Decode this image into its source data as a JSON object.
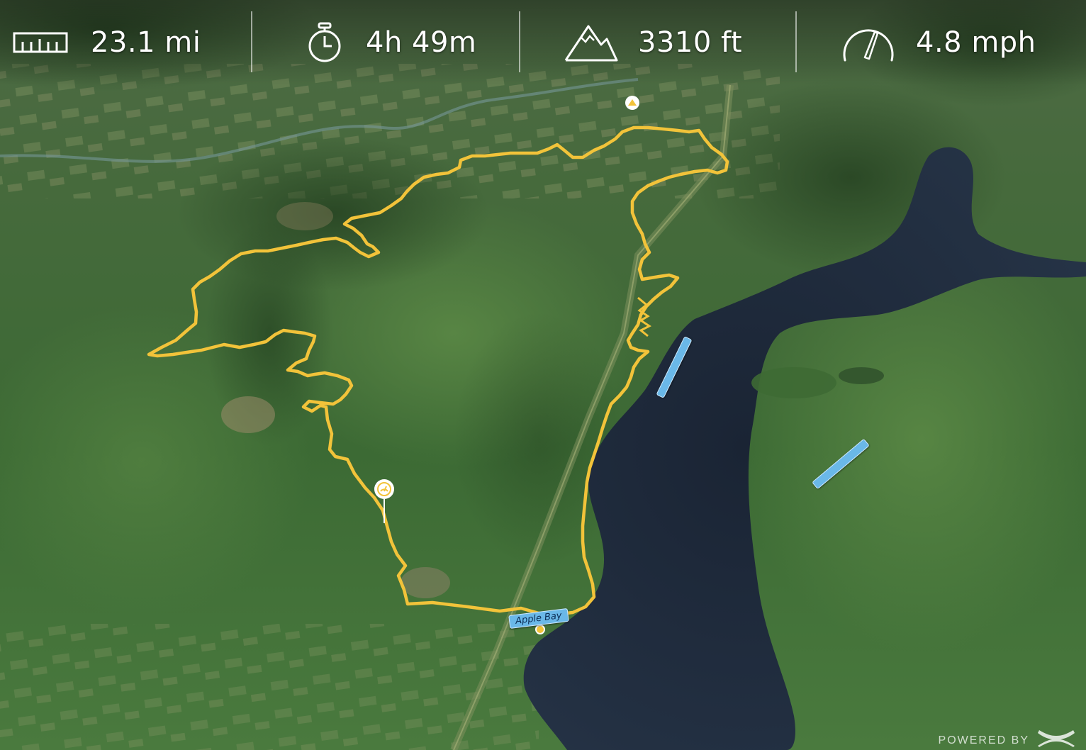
{
  "stats": {
    "distance": {
      "value": "23.1 mi",
      "icon": "ruler-icon"
    },
    "duration": {
      "value": "4h 49m",
      "icon": "stopwatch-icon"
    },
    "elevation": {
      "value": "3310 ft",
      "icon": "mountain-icon"
    },
    "speed": {
      "value": "4.8 mph",
      "icon": "speedometer-icon"
    }
  },
  "map": {
    "route_color": "#f2c33a",
    "water_color": "#1f2b3c",
    "place_labels": [
      "Apple Bay",
      "",
      ""
    ]
  },
  "branding": {
    "text": "POWERED BY",
    "logo": "under-armour-logo"
  }
}
